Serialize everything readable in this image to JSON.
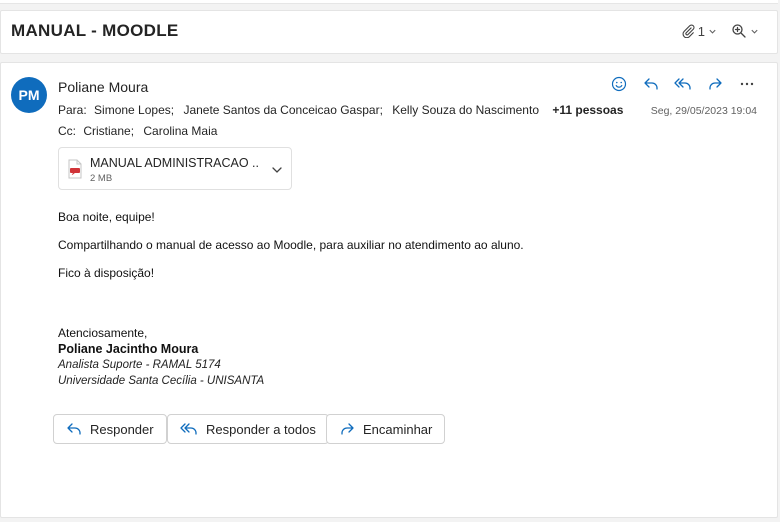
{
  "subject": {
    "title": "MANUAL - MOODLE",
    "attachment_count": "1"
  },
  "message": {
    "avatar_initials": "PM",
    "sender": "Poliane Moura",
    "to_label": "Para:",
    "to": [
      "Simone Lopes;",
      "Janete Santos da Conceicao Gaspar;",
      "Kelly Souza do Nascimento"
    ],
    "to_more": "+11 pessoas",
    "cc_label": "Cc:",
    "cc": [
      "Cristiane;",
      "Carolina Maia"
    ],
    "date": "Seg, 29/05/2023 19:04"
  },
  "attachment": {
    "name": "MANUAL ADMINISTRACAO ...",
    "size": "2 MB"
  },
  "body": {
    "greeting": "Boa noite, equipe!",
    "line1": "Compartilhando o manual de acesso ao Moodle, para auxiliar no atendimento ao aluno.",
    "line2": "Fico à disposição!",
    "closing": "Atenciosamente,",
    "sig_name": "Poliane Jacintho Moura",
    "sig_title": "Analista Suporte - RAMAL 5174",
    "sig_org": "Universidade Santa Cecília - UNISANTA"
  },
  "buttons": {
    "reply": "Responder",
    "reply_all": "Responder a todos",
    "forward": "Encaminhar"
  },
  "icons": {
    "attachment": "paperclip-icon",
    "zoom": "zoom-icon",
    "emoji": "emoji-icon",
    "reply": "reply-icon",
    "reply_all": "reply-all-icon",
    "forward": "forward-icon",
    "more": "more-icon",
    "pdf": "pdf-file-icon"
  },
  "colors": {
    "avatar_bg": "#0f6cbd",
    "accent": "#0f6cbd",
    "pdf_red": "#d13438"
  }
}
